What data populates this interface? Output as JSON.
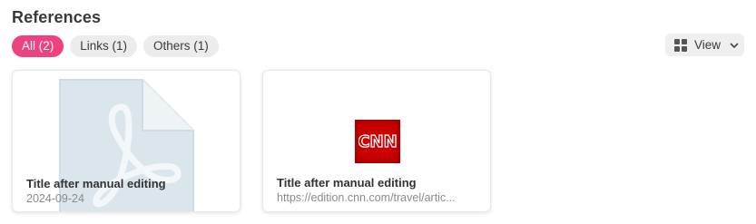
{
  "section": {
    "title": "References"
  },
  "filters": [
    {
      "label": "All (2)",
      "active": true
    },
    {
      "label": "Links (1)",
      "active": false
    },
    {
      "label": "Others (1)",
      "active": false
    }
  ],
  "view_button": {
    "label": "View",
    "icon": "grid-icon",
    "chevron": "chevron-down-icon"
  },
  "cards": [
    {
      "title": "Title after manual editing",
      "subtitle": "2024-09-24",
      "thumbnail": "pdf-file-icon"
    },
    {
      "title": "Title after manual editing",
      "subtitle": "https://edition.cnn.com/travel/artic...",
      "thumbnail": "cnn-logo",
      "logo_text": "CNN"
    }
  ],
  "colors": {
    "accent": "#ee4280",
    "cnn_red": "#cc0000"
  }
}
